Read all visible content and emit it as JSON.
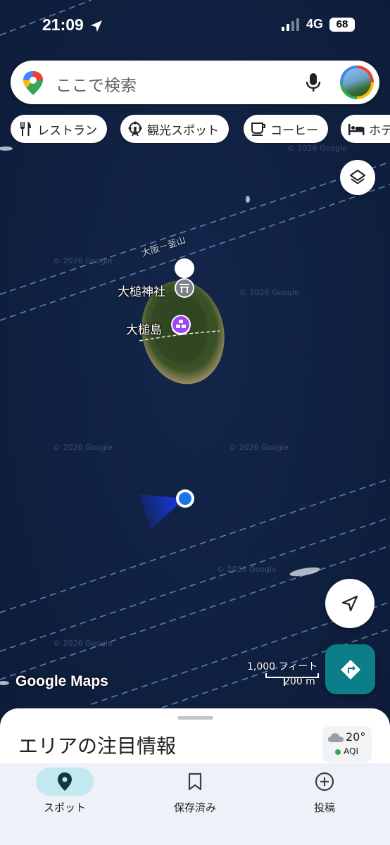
{
  "status_bar": {
    "time": "21:09",
    "network": "4G",
    "battery": "68"
  },
  "search": {
    "placeholder": "ここで検索",
    "icons": [
      "google-maps-pin-icon",
      "mic-icon",
      "avatar"
    ]
  },
  "chips": [
    {
      "label": "レストラン",
      "icon": "fork-knife-icon"
    },
    {
      "label": "観光スポット",
      "icon": "ferris-wheel-icon"
    },
    {
      "label": "コーヒー",
      "icon": "coffee-cup-icon"
    },
    {
      "label": "ホテ",
      "icon": "bed-icon"
    }
  ],
  "map": {
    "route_label": "大阪－釜山",
    "places": [
      {
        "name": "大槌神社",
        "icon": "shrine-icon"
      },
      {
        "name": "大槌島",
        "icon": "island-icon"
      }
    ],
    "watermark": "© 2026 Google",
    "brand": "Google Maps",
    "scale": {
      "feet": "1,000 フィート",
      "meters": "200 m"
    }
  },
  "sheet": {
    "title": "エリアの注目情報",
    "weather": {
      "temp": "20°",
      "aqi": "AQI"
    }
  },
  "bottom_nav": [
    {
      "label": "スポット",
      "icon": "location-pin-icon",
      "active": true
    },
    {
      "label": "保存済み",
      "icon": "bookmark-icon",
      "active": false
    },
    {
      "label": "投稿",
      "icon": "add-circle-icon",
      "active": false
    }
  ],
  "colors": {
    "sea": "#0f1f3f",
    "accent_teal": "#0b7e8a",
    "active_tab_bg": "#c3e8f0",
    "location_dot": "#1a73e8"
  }
}
